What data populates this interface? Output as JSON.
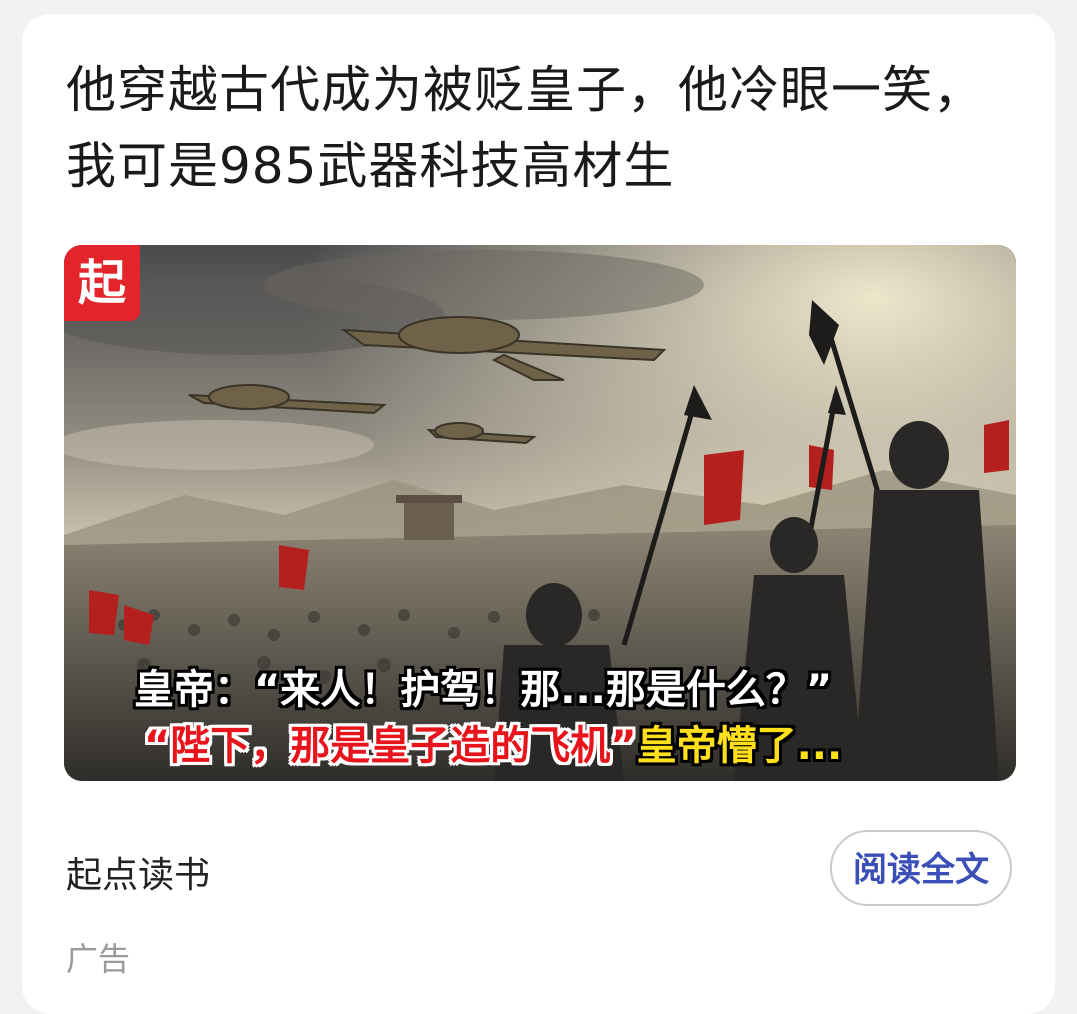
{
  "card": {
    "headline": "他穿越古代成为被贬皇子，他冷眼一笑，我可是985武器科技高材生"
  },
  "hero": {
    "logo_text": "起",
    "caption_line1": "皇帝：“来人！护驾！那...那是什么？”",
    "caption_line2_red": "“陛下，那是皇子造的飞机”",
    "caption_line2_yellow": "皇帝懵了..."
  },
  "footer": {
    "source": "起点读书",
    "read_button": "阅读全文",
    "ad_label": "广告"
  },
  "colors": {
    "brand_red": "#e3242b",
    "button_text": "#3b4fb6"
  }
}
